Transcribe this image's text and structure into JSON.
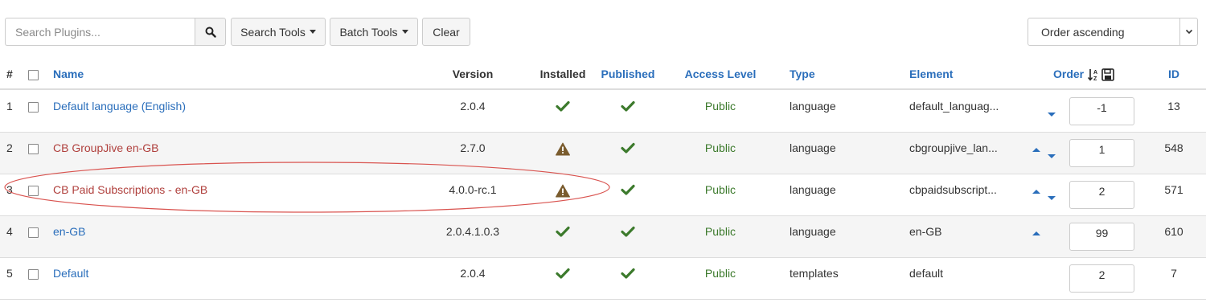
{
  "toolbar": {
    "search_placeholder": "Search Plugins...",
    "search_icon": "search-icon",
    "search_tools_label": "Search Tools",
    "batch_tools_label": "Batch Tools",
    "clear_label": "Clear",
    "ordering_value": "Order ascending"
  },
  "table": {
    "headers": {
      "num": "#",
      "name": "Name",
      "version": "Version",
      "installed": "Installed",
      "published": "Published",
      "access": "Access Level",
      "type": "Type",
      "element": "Element",
      "order": "Order",
      "id": "ID"
    },
    "rows": [
      {
        "num": "1",
        "name": "Default language (English)",
        "name_color": "#2a6ebb",
        "version": "2.0.4",
        "installed": "check",
        "published": "check",
        "access": "Public",
        "type": "language",
        "element": "default_languag...",
        "order_up": false,
        "order_down": true,
        "order": "-1",
        "id": "13"
      },
      {
        "num": "2",
        "name": "CB GroupJive en-GB",
        "name_color": "#b0403d",
        "version": "2.7.0",
        "installed": "warning",
        "published": "check",
        "access": "Public",
        "type": "language",
        "element": "cbgroupjive_lan...",
        "order_up": true,
        "order_down": true,
        "order": "1",
        "id": "548"
      },
      {
        "num": "3",
        "name": "CB Paid Subscriptions - en-GB",
        "name_color": "#b0403d",
        "version": "4.0.0-rc.1",
        "installed": "warning",
        "published": "check",
        "access": "Public",
        "type": "language",
        "element": "cbpaidsubscript...",
        "order_up": true,
        "order_down": true,
        "order": "2",
        "id": "571"
      },
      {
        "num": "4",
        "name": "en-GB",
        "name_color": "#2a6ebb",
        "version": "2.0.4.1.0.3",
        "installed": "check",
        "published": "check",
        "access": "Public",
        "type": "language",
        "element": "en-GB",
        "order_up": true,
        "order_down": false,
        "order": "99",
        "id": "610"
      },
      {
        "num": "5",
        "name": "Default",
        "name_color": "#2a6ebb",
        "version": "2.0.4",
        "installed": "check",
        "published": "check",
        "access": "Public",
        "type": "templates",
        "element": "default",
        "order_up": false,
        "order_down": false,
        "order": "2",
        "id": "7"
      }
    ]
  },
  "colors": {
    "link": "#2a6ebb",
    "danger_link": "#b0403d",
    "success": "#3c7a2c",
    "warning": "#7a5c2e",
    "annotation": "#d9534f"
  }
}
